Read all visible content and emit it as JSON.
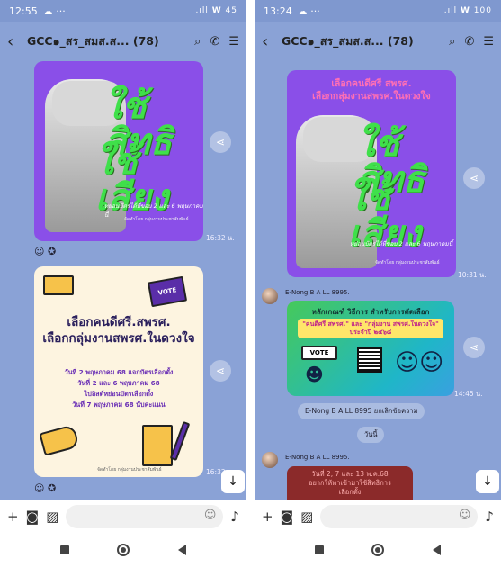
{
  "left": {
    "status": {
      "time": "12:55",
      "right": ".ıll 𝗪 45"
    },
    "header": {
      "title": "GCC๑_สร_สมส.ส... (78)"
    },
    "posters": {
      "line1": "ใช้สิทธิ",
      "line2": "ใช้เสียง",
      "caption": "หย่อนบัตรได้ที่ขอบ 2 และ 6 พฤษภาคมนี้",
      "credit": "จัดทำโดย กลุ่มงานประชาสัมพันธ์"
    },
    "msg1_time": "16:32 น.",
    "vote": {
      "badge": "VOTE",
      "title1": "เลือกคนดีศรี.สพรศ.",
      "title2": "เลือกกลุ่มงานสพรศ.ในดวงใจ",
      "d1": "วันที่ 2 พฤษภาคม 68 แจกบัตรเลือกตั้ง",
      "d2": "วันที่ 2 และ 6 พฤษภาคม 68",
      "d3": "ไปลิสต์หย่อนบัตรเลือกตั้ง",
      "d4": "วันที่ 7 พฤษภาคม 68 นับคะแนน",
      "credit": "จัดทำโดย กลุ่มงานประชาสัมพันธ์"
    },
    "msg2_time": "16:32"
  },
  "right": {
    "status": {
      "time": "13:24",
      "right": ".ıll 𝗪 100"
    },
    "header": {
      "title": "GCC๑_สร_สมส.ส... (78)"
    },
    "poster_title1": "เลือกคนดีศรี สพรศ.",
    "poster_title2": "เลือกกลุ่มงานสพรศ.ในดวงใจ",
    "msg1_time": "10:31 น.",
    "sender1": "E-Nong B A LL 8995.",
    "info": {
      "title": "หลักเกณฑ์ วิธีการ สำหรับการคัดเลือก",
      "highlight1": "\"คนดีศรี สพรศ.\" และ \"กลุ่มงาน สพรศ.ในดวงใจ\"",
      "highlight2": "ประจำปี ๒๕๖๘",
      "badge": "VOTE"
    },
    "msg2_time": "14:45 น.",
    "system_msg": "E-Nong B A LL 8995 ยกเลิกข้อความ",
    "date_pill": "วันนี้",
    "sender2": "E-Nong B A LL 8995.",
    "red": {
      "t1": "วันที่ 2, 7 และ 13 พ.ค.68",
      "t2": "อยากให้พาเข้ามาใช้สิทธิการ",
      "t3": "เลือกตั้ง"
    }
  },
  "icons": {
    "back": "chevron-left-icon",
    "search": "search-icon",
    "call": "phone-icon",
    "menu": "hamburger-icon",
    "share": "share-icon",
    "plus": "plus-icon",
    "camera": "camera-icon",
    "image": "image-icon",
    "emoji": "emoji-icon",
    "mic": "mic-icon",
    "scroll_down": "arrow-down-icon"
  },
  "colors": {
    "chat_bg": "#8aa2d6",
    "poster_purple": "#8a4fe8",
    "hand_green": "#3fe04a"
  }
}
